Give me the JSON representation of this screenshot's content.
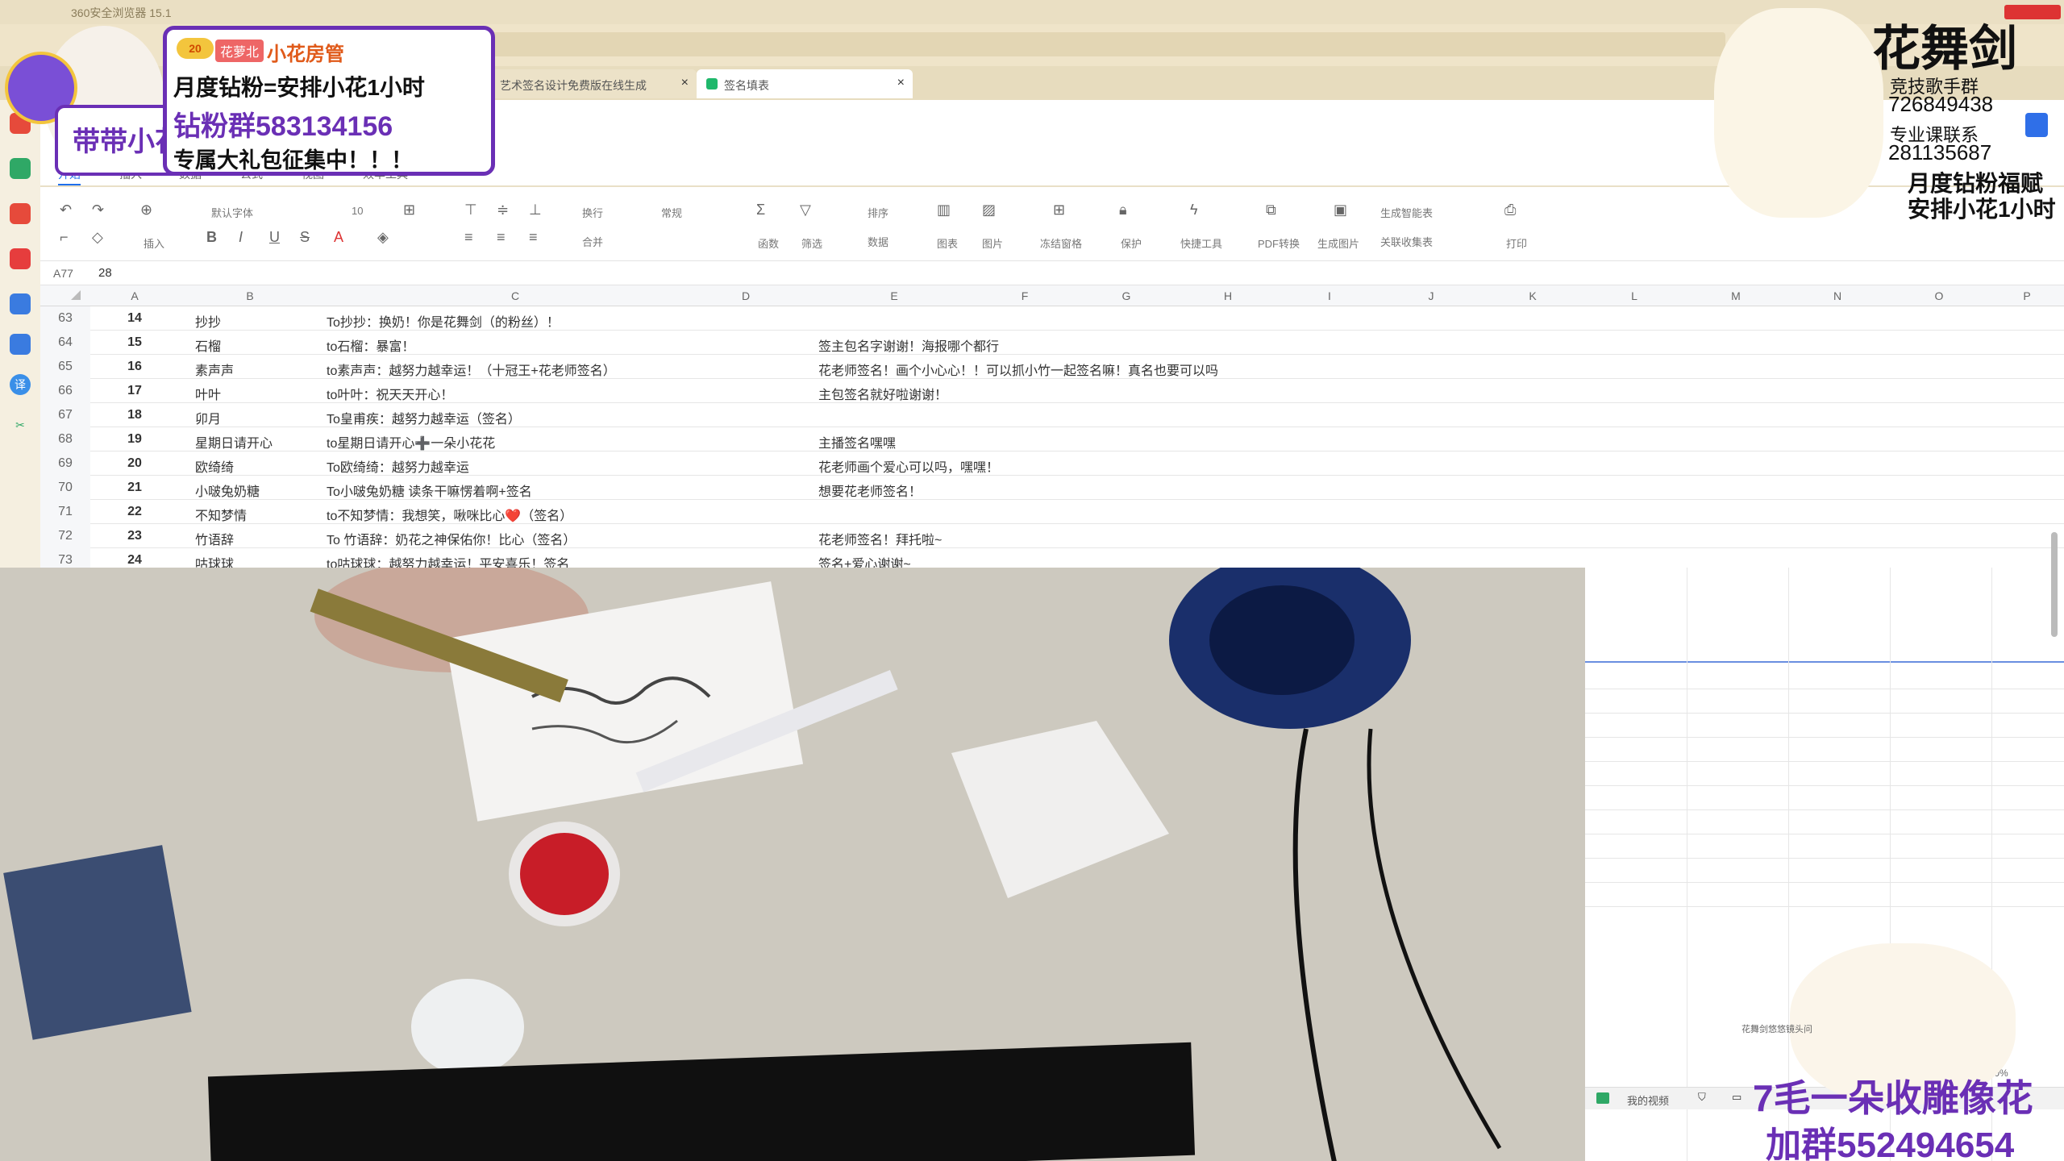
{
  "browser": {
    "title": "360安全浏览器 15.1"
  },
  "tabs": [
    {
      "label": "艺术签名设计免费版在线生成"
    },
    {
      "label": "签名填表"
    }
  ],
  "ribbon": {
    "tabs": [
      "开始",
      "插入",
      "数据",
      "公式",
      "视图",
      "效率工具"
    ],
    "font": "默认字体",
    "size": "10",
    "numfmt": "常规",
    "wrap": "换行",
    "merge": "合并",
    "sort": "排序",
    "tools": [
      "插入",
      "函数",
      "筛选",
      "数据",
      "图表",
      "图片",
      "冻结窗格",
      "保护",
      "快捷工具",
      "PDF转换",
      "生成图片",
      "生成智能表",
      "关联收集表",
      "打印"
    ]
  },
  "formula": {
    "cell": "A77",
    "value": "28"
  },
  "columns": [
    "A",
    "B",
    "C",
    "D",
    "E",
    "F",
    "G",
    "H",
    "I",
    "J",
    "K",
    "L",
    "M",
    "N",
    "O",
    "P"
  ],
  "rows": [
    {
      "n": "63",
      "a": "14",
      "b": "抄抄",
      "c": "To抄抄：换奶！你是花舞剑（的粉丝）！",
      "e": ""
    },
    {
      "n": "64",
      "a": "15",
      "b": "石榴",
      "c": "to石榴：暴富！",
      "e": "签主包名字谢谢！海报哪个都行"
    },
    {
      "n": "65",
      "a": "16",
      "b": "素声声",
      "c": "to素声声：越努力越幸运！（十冠王+花老师签名）",
      "e": "花老师签名！画个小心心！！可以抓小竹一起签名嘛！真名也要可以吗"
    },
    {
      "n": "66",
      "a": "17",
      "b": "叶叶",
      "c": "to叶叶：祝天天开心！",
      "e": "主包签名就好啦谢谢！"
    },
    {
      "n": "67",
      "a": "18",
      "b": "卯月",
      "c": "To皇甫疾：越努力越幸运（签名）",
      "e": ""
    },
    {
      "n": "68",
      "a": "19",
      "b": "星期日请开心",
      "c": "to星期日请开心➕一朵小花花",
      "e": "主播签名嘿嘿"
    },
    {
      "n": "69",
      "a": "20",
      "b": "欧绮绮",
      "c": "To欧绮绮：越努力越幸运",
      "e": "花老师画个爱心可以吗，嘿嘿！"
    },
    {
      "n": "70",
      "a": "21",
      "b": "小啵兔奶糖",
      "c": "To小啵兔奶糖 读条干嘛愣着啊+签名",
      "e": "想要花老师签名！"
    },
    {
      "n": "71",
      "a": "22",
      "b": "不知梦情",
      "c": "to不知梦情：我想笑，啾咪比心❤️（签名）",
      "e": ""
    },
    {
      "n": "72",
      "a": "23",
      "b": "竹语辞",
      "c": "To 竹语辞：奶花之神保佑你！比心（签名）",
      "e": "花老师签名！拜托啦~"
    },
    {
      "n": "73",
      "a": "24",
      "b": "咕球球",
      "c": "to咕球球：越努力越幸运！平安喜乐！签名",
      "e": "签名+爱心谢谢~"
    }
  ],
  "overlay_left": {
    "badge": "20",
    "tag": "花萝北",
    "role": "小花房管",
    "line1": "月度钻粉=安排小花1小时",
    "line2": "钻粉群583134156",
    "line3": "专属大礼包征集中！！！",
    "name": "带带小花"
  },
  "overlay_right": {
    "title": "花舞剑",
    "l1": "竞技歌手群",
    "l2": "726849438",
    "l3": "专业课联系",
    "l4": "281135687",
    "l5": "月度钻粉福赋",
    "l6": "安排小花1小时"
  },
  "overlay_br": {
    "caption": "花舞剑悠悠镜头问",
    "l1": "7毛一朵收雕像花",
    "l2": "加群552494654"
  },
  "video_bar": {
    "label": "我的视频",
    "zoom": "100%"
  },
  "colors": {
    "accent": "#1f6feb",
    "purple": "#6a2fb5",
    "gold": "#f3c53d"
  }
}
